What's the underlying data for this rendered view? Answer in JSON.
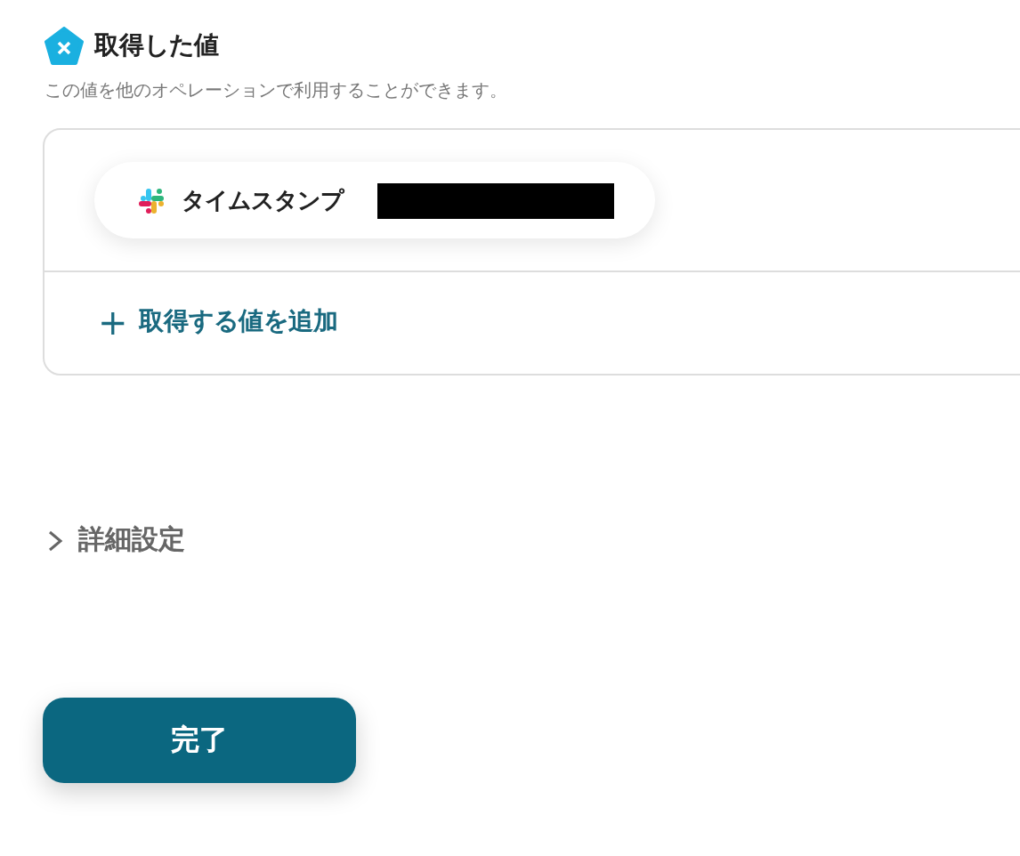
{
  "section": {
    "title": "取得した値",
    "description": "この値を他のオペレーションで利用することができます。"
  },
  "values": [
    {
      "label": "タイムスタンプ",
      "redacted": true
    }
  ],
  "add_button": {
    "label": "取得する値を追加",
    "icon": "+"
  },
  "details": {
    "label": "詳細設定",
    "expanded": false
  },
  "submit_button": {
    "label": "完了"
  }
}
